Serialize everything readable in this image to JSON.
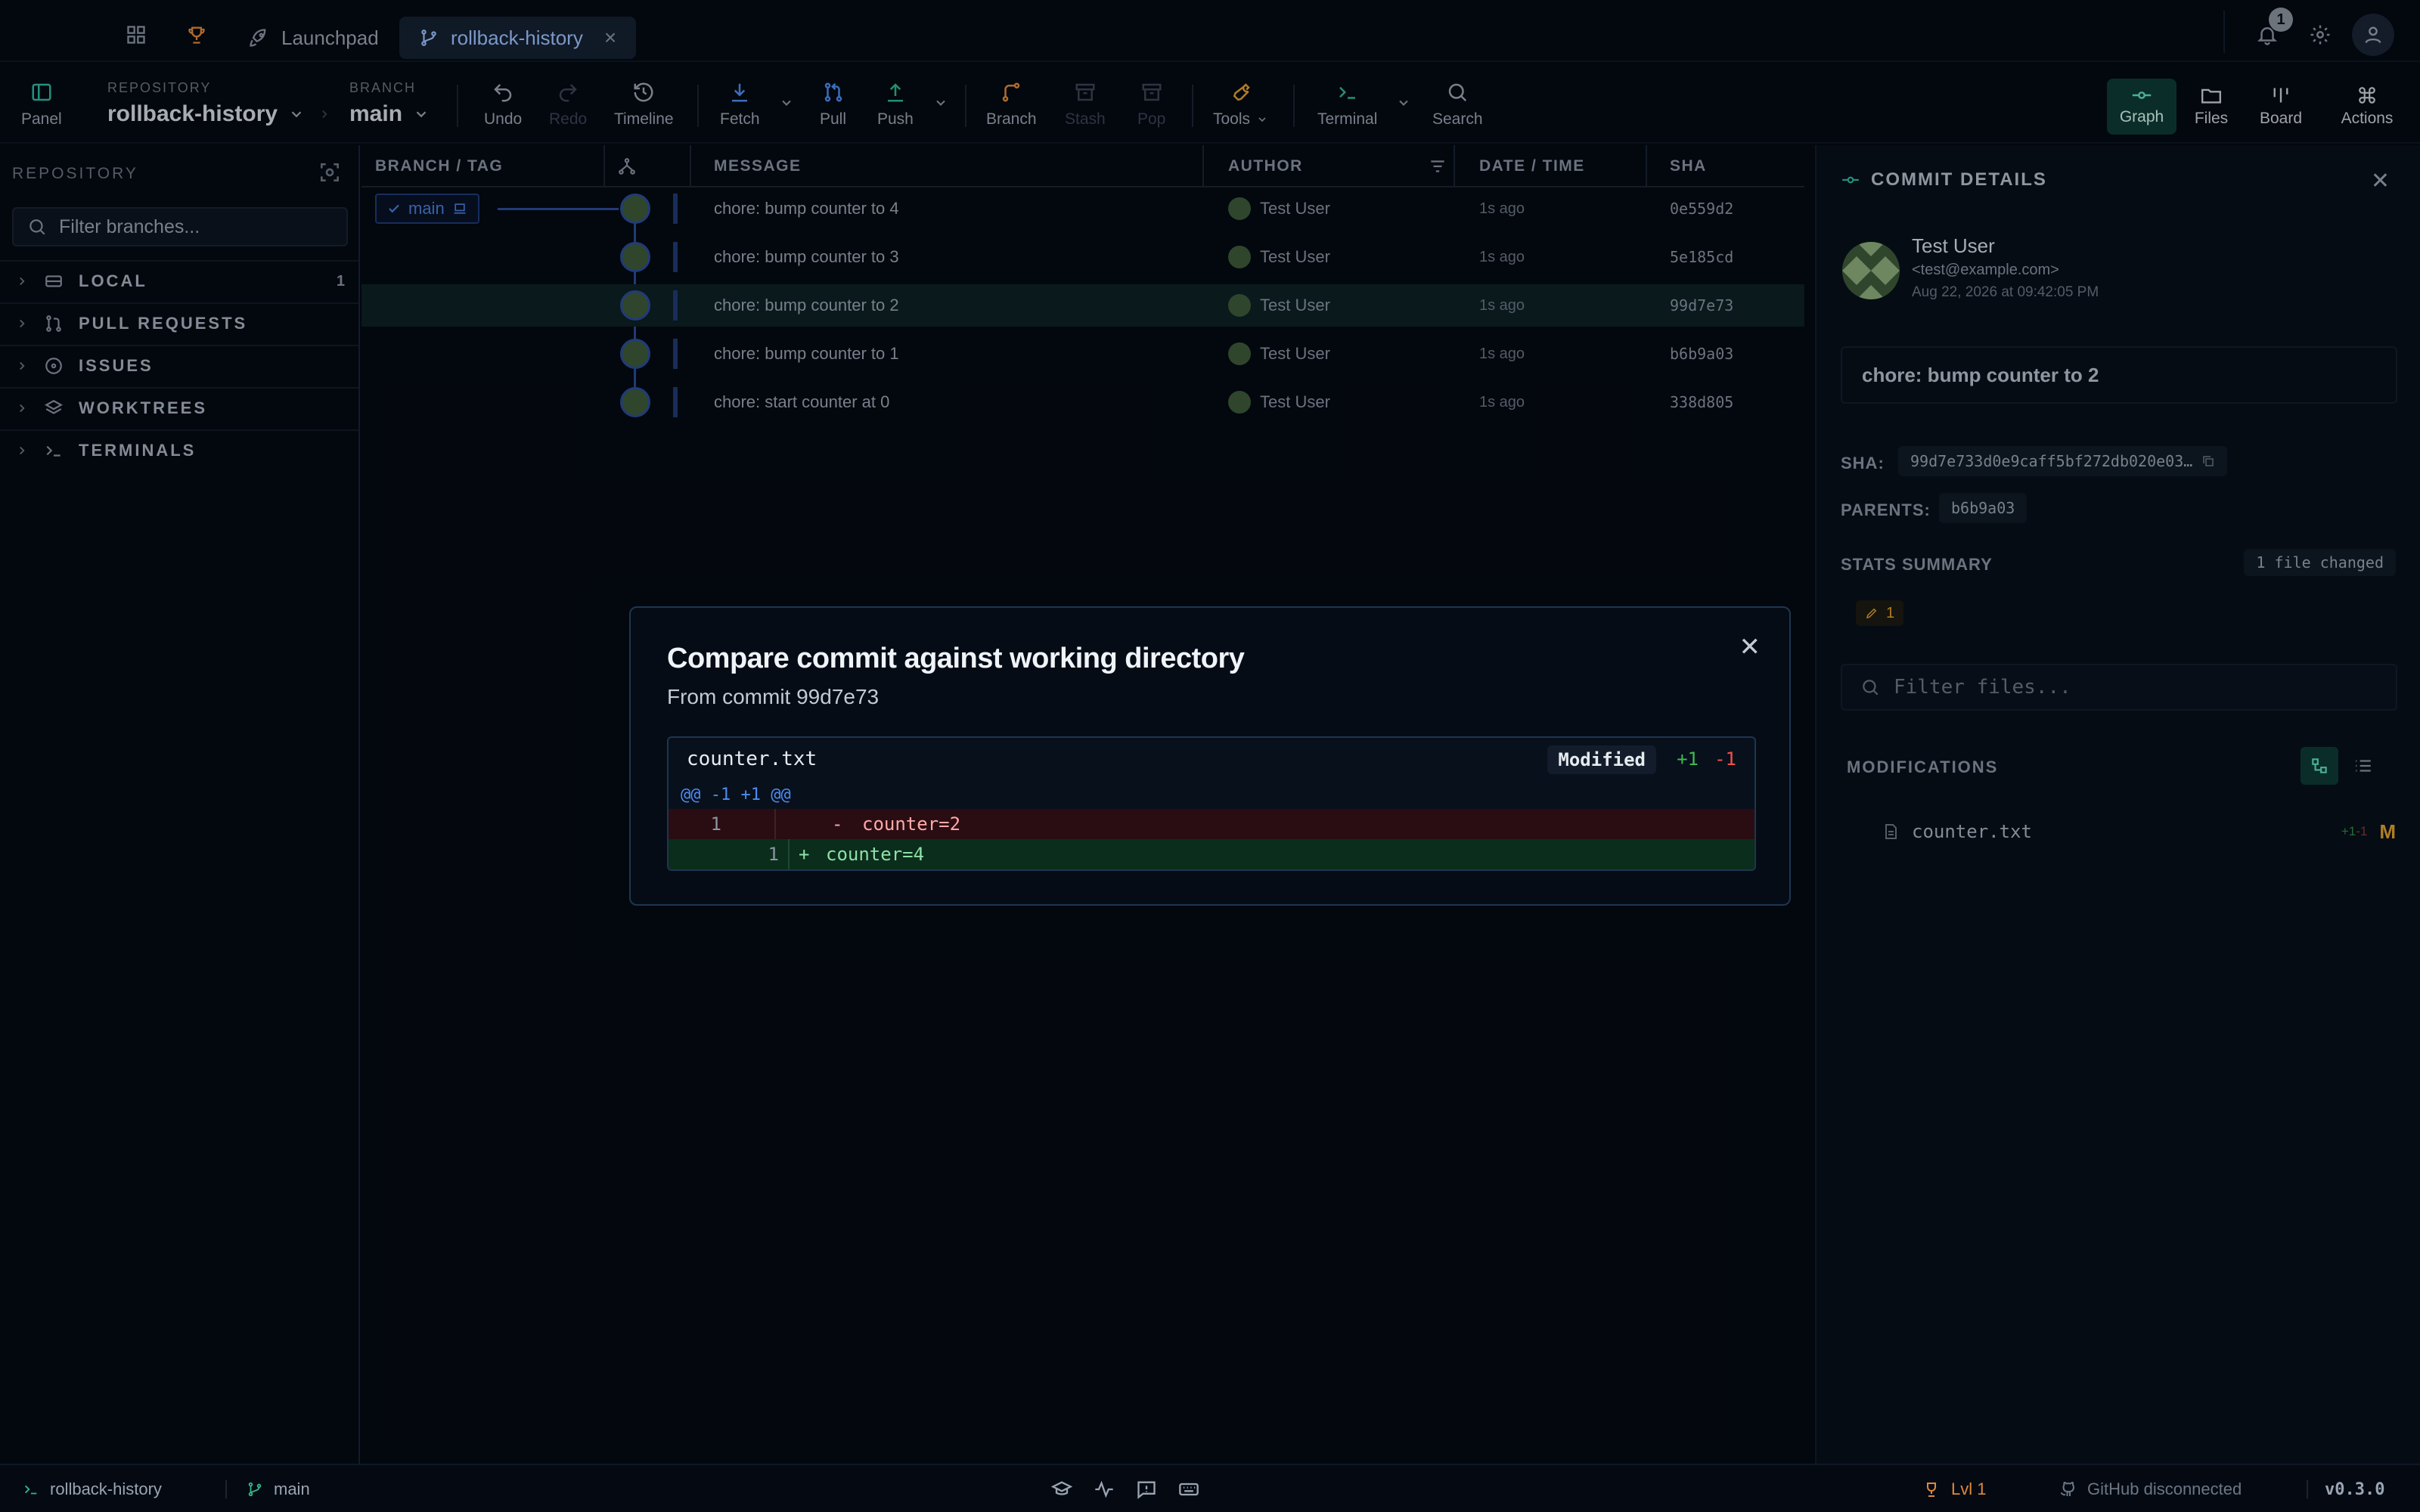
{
  "tabs": {
    "launchpad_label": "Launchpad",
    "repo_tab_label": "rollback-history",
    "close_glyph": "×"
  },
  "topbar": {
    "notification_count": "1"
  },
  "toolbar": {
    "panel_label": "Panel",
    "repository_caption": "REPOSITORY",
    "repository_name": "rollback-history",
    "branch_caption": "BRANCH",
    "branch_name": "main",
    "undo": "Undo",
    "redo": "Redo",
    "timeline": "Timeline",
    "fetch": "Fetch",
    "pull": "Pull",
    "push": "Push",
    "branch": "Branch",
    "stash": "Stash",
    "pop": "Pop",
    "tools": "Tools",
    "terminal": "Terminal",
    "search": "Search",
    "views": {
      "graph": "Graph",
      "files": "Files",
      "board": "Board",
      "actions": "Actions"
    }
  },
  "sidebar": {
    "heading": "REPOSITORY",
    "filter_placeholder": "Filter branches...",
    "items": [
      {
        "label": "LOCAL",
        "count": "1",
        "icon": "drive-icon"
      },
      {
        "label": "PULL REQUESTS",
        "count": "",
        "icon": "pull-request-icon"
      },
      {
        "label": "ISSUES",
        "count": "",
        "icon": "issue-circle-icon"
      },
      {
        "label": "WORKTREES",
        "count": "",
        "icon": "layers-icon"
      },
      {
        "label": "TERMINALS",
        "count": "",
        "icon": "terminal-prompt-icon"
      }
    ]
  },
  "graph": {
    "columns": {
      "branch_tag": "BRANCH / TAG",
      "message": "MESSAGE",
      "author": "AUTHOR",
      "date_time": "DATE / TIME",
      "sha": "SHA"
    },
    "branch_tag": "main",
    "selected_index": 2,
    "commits": [
      {
        "message": "chore: bump counter to 4",
        "author": "Test User",
        "date": "1s ago",
        "sha": "0e559d2"
      },
      {
        "message": "chore: bump counter to 3",
        "author": "Test User",
        "date": "1s ago",
        "sha": "5e185cd"
      },
      {
        "message": "chore: bump counter to 2",
        "author": "Test User",
        "date": "1s ago",
        "sha": "99d7e73"
      },
      {
        "message": "chore: bump counter to 1",
        "author": "Test User",
        "date": "1s ago",
        "sha": "b6b9a03"
      },
      {
        "message": "chore: start counter at 0",
        "author": "Test User",
        "date": "1s ago",
        "sha": "338d805"
      }
    ]
  },
  "details": {
    "title": "COMMIT DETAILS",
    "author_name": "Test User",
    "author_email": "<test@example.com>",
    "date": "Aug 22, 2026 at 09:42:05 PM",
    "message": "chore: bump counter to 2",
    "sha_label": "SHA:",
    "sha_value": "99d7e733d0e9caff5bf272db020e03…",
    "parents_label": "PARENTS:",
    "parent": "b6b9a03",
    "stats_label": "STATS SUMMARY",
    "files_changed": "1 file changed",
    "modified_count": "1",
    "filter_placeholder": "Filter files...",
    "modifications_label": "MODIFICATIONS",
    "file_name": "counter.txt",
    "file_add": "+1",
    "file_del": "-1",
    "file_status": "M"
  },
  "modal": {
    "title": "Compare commit against working directory",
    "subtitle": "From commit 99d7e73",
    "file_name": "counter.txt",
    "status_badge": "Modified",
    "additions": "+1",
    "deletions": "-1",
    "hunk_header": "@@ -1 +1 @@",
    "removed_line_number": "1",
    "removed_sign": "-",
    "removed_code": "counter=2",
    "added_line_number": "1",
    "added_sign": "+",
    "added_code": "counter=4"
  },
  "statusbar": {
    "repo": "rollback-history",
    "branch": "main",
    "level": "Lvl 1",
    "github": "GitHub disconnected",
    "version": "v0.3.0"
  },
  "colors": {
    "background": "#050a12",
    "accent_teal": "#0f3a35",
    "branch_blue": "#1f3a75",
    "diff_removed": "#2a0d12",
    "diff_added": "#0b2d1c",
    "addition_green": "#3fb950",
    "deletion_red": "#f85149",
    "warning_orange": "#e0a030"
  }
}
